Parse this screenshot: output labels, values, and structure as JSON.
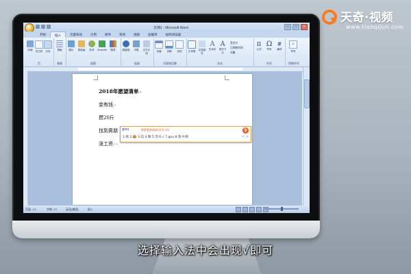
{
  "word": {
    "title": "文档1 - Microsoft Word",
    "tabs": [
      "开始",
      "插入",
      "页面布局",
      "引用",
      "邮件",
      "审阅",
      "视图",
      "加载项",
      "福昕阅读器"
    ],
    "ribbon_groups": [
      {
        "name": "页",
        "buttons": [
          "封面",
          "空白页",
          "分页"
        ]
      },
      {
        "name": "表格",
        "buttons": [
          "表格"
        ]
      },
      {
        "name": "插图",
        "buttons": [
          "图片",
          "剪贴画",
          "形状",
          "SmartArt",
          "图表"
        ]
      },
      {
        "name": "链接",
        "buttons": [
          "超链接",
          "书签",
          "交叉引用"
        ]
      },
      {
        "name": "页眉和页脚",
        "buttons": [
          "页眉",
          "页脚",
          "页码"
        ]
      },
      {
        "name": "文本",
        "buttons": [
          "文本框",
          "文档部件",
          "艺术字",
          "首字下沉"
        ]
      },
      {
        "name": "符号",
        "buttons": [
          "公式",
          "符号",
          "编号"
        ]
      },
      {
        "name": "特殊符号",
        "buttons": [
          "符号"
        ]
      }
    ],
    "text_group_small": [
      "签名行",
      "日期和时间",
      "对象"
    ],
    "document_lines": [
      {
        "text": "2018年愿望清单",
        "mark": "↵"
      },
      {
        "text": "变有钱",
        "mark": "↵"
      },
      {
        "text": "攒20斤",
        "mark": ""
      },
      {
        "text": "找到男朋",
        "mark": ""
      },
      {
        "text": "涨工资",
        "mark": "√↵"
      }
    ],
    "ime": {
      "input": "gou",
      "hint": "搜索更多候选(分号+G)",
      "logo": "S",
      "candidates": "1.购 2.🍪 3.勾 4.够 5.沟 6.√ 7.gou 8.狗 9.构",
      "nav": "< >"
    },
    "status": {
      "page": "页面: 1/1",
      "words": "字数: 23",
      "lang": "英语(美国)",
      "mode": "插入"
    }
  },
  "watermark": {
    "title": "天奇·视频",
    "url": "www.tianqijun.com"
  },
  "subtitle": "选择输入法中会出现√即可"
}
